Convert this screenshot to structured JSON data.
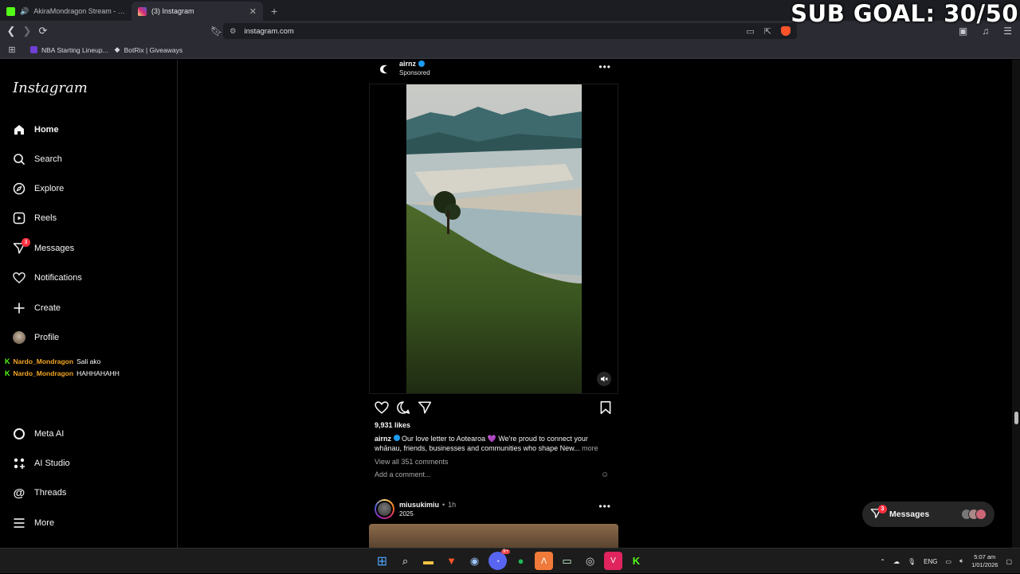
{
  "browser": {
    "tabs": [
      {
        "title": "AkiraMondragon Stream - Watch",
        "icon": "kick-icon",
        "color": "#53fc18",
        "active": false
      },
      {
        "title": "(3) Instagram",
        "icon": "instagram-icon",
        "color": "#d62976",
        "active": true
      }
    ],
    "url": "instagram.com",
    "bookmarks": [
      {
        "label": "NBA Starting Lineup...",
        "color": "#6f3fd6"
      },
      {
        "label": "BotRix | Giveaways",
        "color": "#ffffff"
      }
    ]
  },
  "overlay": {
    "sub_goal": "SUB GOAL: 30/50"
  },
  "instagram": {
    "logo": "Instagram",
    "nav": [
      {
        "label": "Home",
        "icon": "home-icon",
        "bold": true
      },
      {
        "label": "Search",
        "icon": "search-icon"
      },
      {
        "label": "Explore",
        "icon": "compass-icon"
      },
      {
        "label": "Reels",
        "icon": "reels-icon"
      },
      {
        "label": "Messages",
        "icon": "messenger-icon",
        "badge": "3"
      },
      {
        "label": "Notifications",
        "icon": "heart-icon"
      },
      {
        "label": "Create",
        "icon": "plus-icon"
      },
      {
        "label": "Profile",
        "icon": "avatar"
      }
    ],
    "nav_bottom": [
      {
        "label": "Meta AI",
        "icon": "meta-ai-icon"
      },
      {
        "label": "AI Studio",
        "icon": "ai-studio-icon"
      },
      {
        "label": "Threads",
        "icon": "threads-icon"
      },
      {
        "label": "More",
        "icon": "menu-icon"
      }
    ],
    "chat": [
      {
        "user": "Nardo_Mondragon",
        "message": "Sali ako"
      },
      {
        "user": "Nardo_Mondragon",
        "message": "HAHHAHAHH"
      }
    ],
    "post1": {
      "username": "airnz",
      "subtitle": "Sponsored",
      "likes": "9,931 likes",
      "caption_user": "airnz",
      "caption_text": "Our love letter to Aotearoa 💜 We're proud to connect your whānau, friends, businesses and communities who shape New...",
      "more": "more",
      "view_comments": "View all 351 comments",
      "add_comment": "Add a comment..."
    },
    "post2": {
      "username": "miusukimiu",
      "time": "1h",
      "subtitle": "2025"
    },
    "messages_pill": {
      "label": "Messages",
      "badge": "3"
    }
  },
  "taskbar": {
    "apps": [
      "windows-start-icon",
      "search-icon",
      "file-explorer-icon",
      "brave-icon",
      "steam-icon",
      "discord-icon",
      "spotify-icon",
      "app-icon",
      "terminal-icon",
      "obs-icon",
      "valorant-icon",
      "kick-icon"
    ],
    "discord_badge": "9+",
    "language": "ENG",
    "time": "5:07 am",
    "date": "1/01/2026"
  }
}
